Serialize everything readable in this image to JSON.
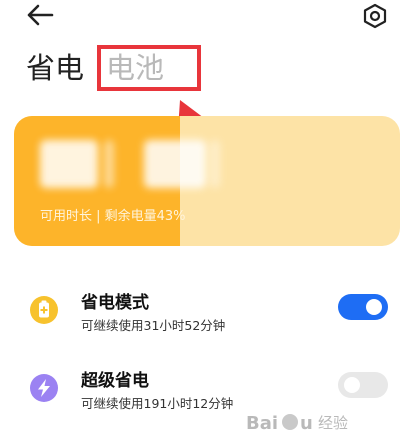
{
  "tabs": {
    "active": "省电",
    "inactive": "电池"
  },
  "battery": {
    "info": "可用时长 | 剩余电量43%",
    "level_fraction": 0.43
  },
  "modes": [
    {
      "title": "省电模式",
      "subtitle": "可继续使用31小时52分钟",
      "enabled": true,
      "icon": "battery-plus-icon",
      "icon_color": "#f7c22d"
    },
    {
      "title": "超级省电",
      "subtitle": "可继续使用191小时12分钟",
      "enabled": false,
      "icon": "lightning-icon",
      "icon_color": "#9b82f2"
    }
  ],
  "colors": {
    "accent_blue": "#1e6df4",
    "battery_fill": "#fdb42a",
    "battery_track": "#fde3a6",
    "highlight_red": "#e8353b"
  },
  "watermark": "Baidu 经验"
}
